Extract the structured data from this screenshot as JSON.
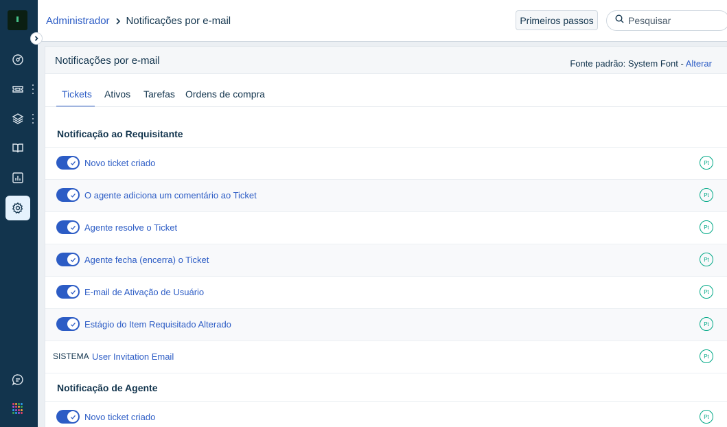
{
  "header": {
    "breadcrumb_parent": "Administrador",
    "breadcrumb_current": "Notificações por e-mail",
    "start_button": "Primeiros passos",
    "search_placeholder": "Pesquisar"
  },
  "panel": {
    "title": "Notificações por e-mail",
    "font_label": "Fonte padrão: System Font -",
    "font_change_link": "Alterar"
  },
  "tabs": [
    {
      "label": "Tickets",
      "active": true
    },
    {
      "label": "Ativos",
      "active": false
    },
    {
      "label": "Tarefas",
      "active": false
    },
    {
      "label": "Ordens de compra",
      "active": false
    }
  ],
  "sections": [
    {
      "title": "Notificação ao Requisitante",
      "rows": [
        {
          "label": "Novo ticket criado",
          "enabled": true,
          "lang": "Pt"
        },
        {
          "label": "O agente adiciona um comentário ao Ticket",
          "enabled": true,
          "lang": "Pt"
        },
        {
          "label": "Agente resolve o Ticket",
          "enabled": true,
          "lang": "Pt"
        },
        {
          "label": "Agente fecha (encerra) o Ticket",
          "enabled": true,
          "lang": "Pt"
        },
        {
          "label": "E-mail de Ativação de Usuário",
          "enabled": true,
          "lang": "Pt"
        },
        {
          "label": "Estágio do Item Requisitado Alterado",
          "enabled": true,
          "lang": "Pt"
        },
        {
          "label": "User Invitation Email",
          "system_tag": "SISTEMA",
          "lang": "Pt"
        }
      ]
    },
    {
      "title": "Notificação de Agente",
      "rows": [
        {
          "label": "Novo ticket criado",
          "enabled": true,
          "lang": "Pt"
        }
      ]
    }
  ],
  "colors": {
    "sidebar": "#12344d",
    "accent": "#2c5cc5",
    "badge": "#00a886"
  }
}
